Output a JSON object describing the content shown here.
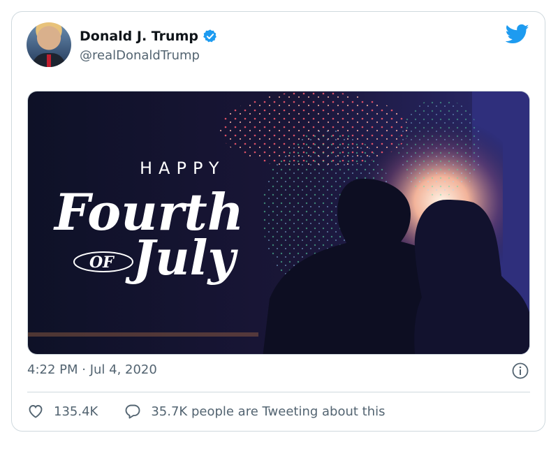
{
  "tweet": {
    "author_name": "Donald J. Trump",
    "author_handle": "@realDonaldTrump",
    "timestamp": "4:22 PM · Jul 4, 2020",
    "like_count": "135.4K",
    "retweet_text": "35.7K people are Tweeting about this"
  },
  "media": {
    "line1": "HAPPY",
    "line2": "Fourth",
    "line3_small": "OF",
    "line3": "July"
  },
  "icons": {
    "verified": "verified-badge-icon",
    "brand": "twitter-bird-icon",
    "info": "info-icon",
    "like": "heart-icon",
    "reply": "speech-bubble-icon"
  },
  "colors": {
    "accent": "#1d9bf0",
    "muted_text": "#536471",
    "border": "#cfd9de"
  }
}
